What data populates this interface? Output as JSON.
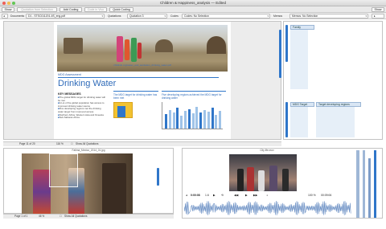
{
  "window": {
    "title": "Children & Happiness_analysis — Edited"
  },
  "toolbar": {
    "show_label": "Show",
    "quotation_from_selection": "Quotation from Selection",
    "add_coding": "Add Coding",
    "code_in_vivo": "Code in Vivo",
    "quick_coding": "Quick Coding",
    "show_right": "Show"
  },
  "filters": {
    "documents_label": "Documents",
    "documents_value": "D1 - STSC011201-IIS_eng.pdf",
    "quotations_label": "Quotations",
    "quotations_value": "Quotation 3",
    "codes_label": "Codes",
    "codes_value": "Codes: No Selection",
    "memos_label": "Memos",
    "memos_value": "Memos: No Selection"
  },
  "document": {
    "url": "childinfo.org/water_and_sanitation_drinking_water.pdf",
    "section_head": "MDG Assessment",
    "title": "Drinking Water",
    "key_messages_head": "KEY MESSAGES",
    "bullets": [
      "The global MDG target for drinking water will be met",
      "A Lot of the global population has access to improved drinking water source",
      "Five developing regions met the drinking water target from improved access",
      "Northern Africa, Western Asia and Oceania",
      "Sub-Saharan Africa"
    ],
    "box1": "The MDG target for drinking water has been met",
    "box2": "Five developing regions achieved the MDG target for drinking water",
    "chart_bars": [
      0.55,
      0.7,
      0.62,
      0.8,
      0.5,
      0.66,
      0.74,
      0.58,
      0.82,
      0.6,
      0.7,
      0.64,
      0.78,
      0.52,
      0.68
    ]
  },
  "codes_panel": {
    "family_code": "Family",
    "mdg_target_code": "MDG Target",
    "target_dev_code": "Target developing regions"
  },
  "doc_status": {
    "page": "Page 11 of 20",
    "zoom": "116 %",
    "show_all": "Show All Quotations"
  },
  "image_panel": {
    "title": "Fatima_Mexico_2014_01.jpg",
    "page": "Page 1 of 1",
    "zoom": "46 %",
    "show_all": "Show All Quotations"
  },
  "video_panel": {
    "title": "City life.mov",
    "time_start": "0:00:08",
    "speed": "1.6",
    "zoom": "100 %",
    "time_end": "00:09:06"
  }
}
